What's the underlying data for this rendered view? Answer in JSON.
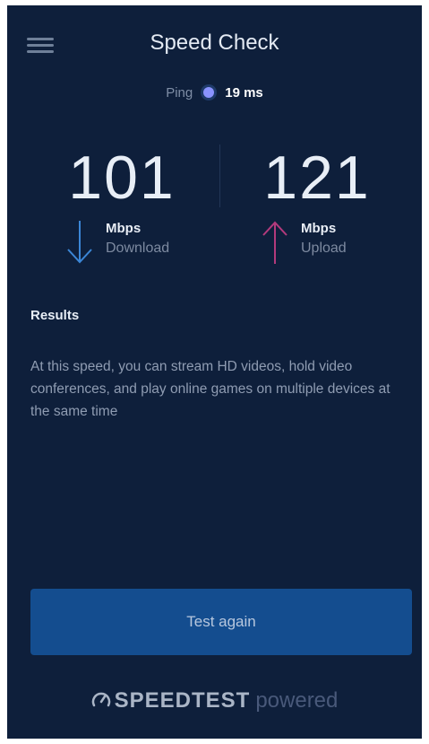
{
  "header": {
    "title": "Speed Check"
  },
  "ping": {
    "label": "Ping",
    "value": "19 ms"
  },
  "download": {
    "value": "101",
    "unit": "Mbps",
    "label": "Download",
    "arrow_color": "#3b86d6"
  },
  "upload": {
    "value": "121",
    "unit": "Mbps",
    "label": "Upload",
    "arrow_color": "#b23a7c"
  },
  "results": {
    "heading": "Results",
    "text": "At this speed, you can stream HD videos, hold video conferences, and play online games on multiple devices at the same time"
  },
  "actions": {
    "test_again": "Test again"
  },
  "footer": {
    "brand": "SPEEDTEST",
    "suffix": "powered"
  },
  "colors": {
    "background": "#0e1f3b",
    "button": "#144d8f",
    "ping_dot": "#8a93ff"
  }
}
